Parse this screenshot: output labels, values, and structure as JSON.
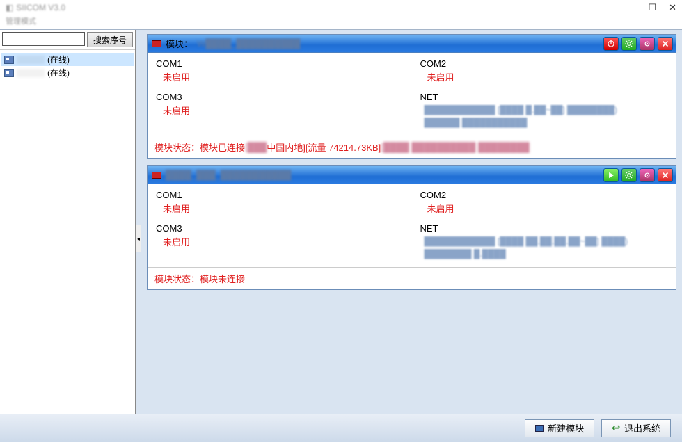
{
  "title": "SIICOM V3.0",
  "subtitle": "管理模式",
  "win": {
    "min": "—",
    "max": "☐",
    "close": "✕"
  },
  "search": {
    "btn": "搜索序号",
    "placeholder": ""
  },
  "tree": [
    {
      "suffix": "(在线)"
    },
    {
      "suffix": "(在线)"
    }
  ],
  "modules": [
    {
      "prefix": "模块：",
      "title_blur": "W████_██████████",
      "icons": [
        "power",
        "gear",
        "settings2",
        "close"
      ],
      "ports": {
        "com1": {
          "label": "COM1",
          "value": "未启用"
        },
        "com2": {
          "label": "COM2",
          "value": "未启用"
        },
        "com3": {
          "label": "COM3",
          "value": "未启用"
        },
        "net": {
          "label": "NET",
          "line1": "████████████ [████ █.██~██] ████████)",
          "line2": "██████ ███████████"
        }
      },
      "status": {
        "pre": "模块状态：模块已连接",
        "blur1": "[███",
        "mid": " 中国内地][流量 74214.73KB]",
        "blur2": "[████ ██████████ ████████"
      }
    },
    {
      "prefix": "",
      "title_blur": "████_███_███████████",
      "icons": [
        "play",
        "gear",
        "settings2",
        "close"
      ],
      "ports": {
        "com1": {
          "label": "COM1",
          "value": "未启用"
        },
        "com2": {
          "label": "COM2",
          "value": "未启用"
        },
        "com3": {
          "label": "COM3",
          "value": "未启用"
        },
        "net": {
          "label": "NET",
          "line1": "████████████ [████ ██.██.██.██~██] ████)",
          "line2": "████████ █.████"
        }
      },
      "status": {
        "pre": "模块状态：模块未连接",
        "blur1": "",
        "mid": "",
        "blur2": ""
      }
    }
  ],
  "footer": {
    "new": "新建模块",
    "exit": "退出系统"
  }
}
